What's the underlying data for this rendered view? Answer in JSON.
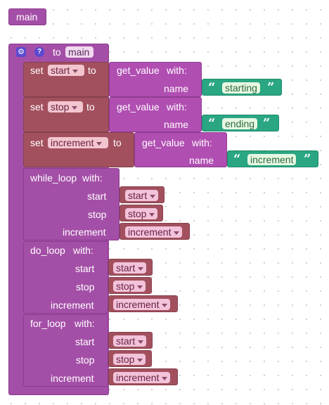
{
  "main_call_label": "main",
  "procedure": {
    "to_label": "to",
    "name": "main"
  },
  "sets": [
    {
      "keyword": "set",
      "var": "start",
      "to": "to",
      "get": "get_value",
      "with": "with:",
      "name_label": "name",
      "string": "starting"
    },
    {
      "keyword": "set",
      "var": "stop",
      "to": "to",
      "get": "get_value",
      "with": "with:",
      "name_label": "name",
      "string": "ending"
    },
    {
      "keyword": "set",
      "var": "increment",
      "to": "to",
      "get": "get_value",
      "with": "with:",
      "name_label": "name",
      "string": "increment"
    }
  ],
  "loops": [
    {
      "name": "while_loop",
      "with": "with:",
      "args": [
        {
          "label": "start",
          "value": "start"
        },
        {
          "label": "stop",
          "value": "stop"
        },
        {
          "label": "increment",
          "value": "increment"
        }
      ]
    },
    {
      "name": "do_loop",
      "with": "with:",
      "args": [
        {
          "label": "start",
          "value": "start"
        },
        {
          "label": "stop",
          "value": "stop"
        },
        {
          "label": "increment",
          "value": "increment"
        }
      ]
    },
    {
      "name": "for_loop",
      "with": "with:",
      "args": [
        {
          "label": "start",
          "value": "start"
        },
        {
          "label": "stop",
          "value": "stop"
        },
        {
          "label": "increment",
          "value": "increment"
        }
      ]
    }
  ],
  "icons": {
    "gear": "gear-icon",
    "help": "help-icon",
    "dropdown": "dropdown-arrow-icon"
  },
  "colors": {
    "procedure": "#a44fa7",
    "variable": "#a3505e",
    "string": "#2aa683",
    "icon": "#5a4ad1"
  }
}
